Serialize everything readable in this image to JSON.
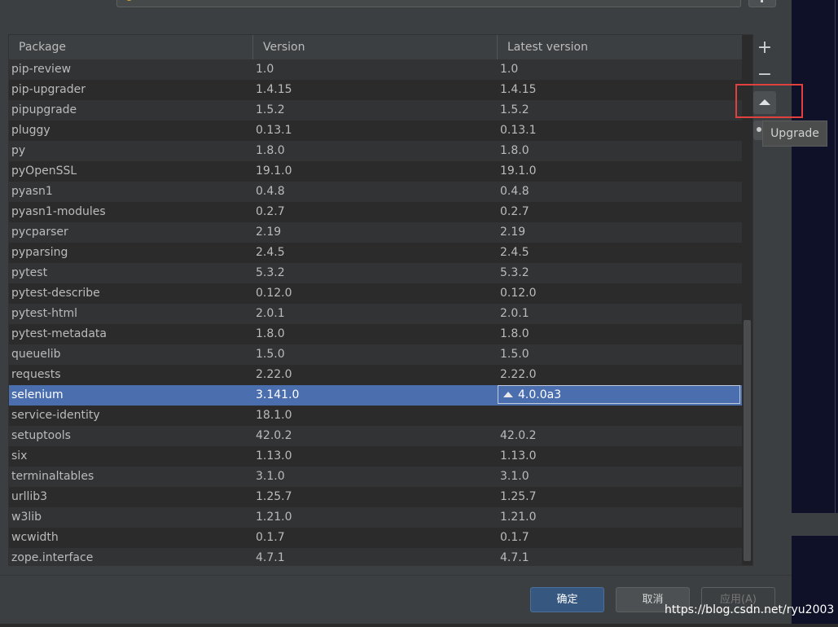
{
  "table": {
    "columns": [
      "Package",
      "Version",
      "Latest version"
    ],
    "rows": [
      {
        "package": "pip-review",
        "version": "1.0",
        "latest": "1.0"
      },
      {
        "package": "pip-upgrader",
        "version": "1.4.15",
        "latest": "1.4.15"
      },
      {
        "package": "pipupgrade",
        "version": "1.5.2",
        "latest": "1.5.2"
      },
      {
        "package": "pluggy",
        "version": "0.13.1",
        "latest": "0.13.1"
      },
      {
        "package": "py",
        "version": "1.8.0",
        "latest": "1.8.0"
      },
      {
        "package": "pyOpenSSL",
        "version": "19.1.0",
        "latest": "19.1.0"
      },
      {
        "package": "pyasn1",
        "version": "0.4.8",
        "latest": "0.4.8"
      },
      {
        "package": "pyasn1-modules",
        "version": "0.2.7",
        "latest": "0.2.7"
      },
      {
        "package": "pycparser",
        "version": "2.19",
        "latest": "2.19"
      },
      {
        "package": "pyparsing",
        "version": "2.4.5",
        "latest": "2.4.5"
      },
      {
        "package": "pytest",
        "version": "5.3.2",
        "latest": "5.3.2"
      },
      {
        "package": "pytest-describe",
        "version": "0.12.0",
        "latest": "0.12.0"
      },
      {
        "package": "pytest-html",
        "version": "2.0.1",
        "latest": "2.0.1"
      },
      {
        "package": "pytest-metadata",
        "version": "1.8.0",
        "latest": "1.8.0"
      },
      {
        "package": "queuelib",
        "version": "1.5.0",
        "latest": "1.5.0"
      },
      {
        "package": "requests",
        "version": "2.22.0",
        "latest": "2.22.0"
      },
      {
        "package": "selenium",
        "version": "3.141.0",
        "latest": "4.0.0a3",
        "selected": true,
        "upgrade_available": true
      },
      {
        "package": "service-identity",
        "version": "18.1.0",
        "latest": ""
      },
      {
        "package": "setuptools",
        "version": "42.0.2",
        "latest": "42.0.2"
      },
      {
        "package": "six",
        "version": "1.13.0",
        "latest": "1.13.0"
      },
      {
        "package": "terminaltables",
        "version": "3.1.0",
        "latest": "3.1.0"
      },
      {
        "package": "urllib3",
        "version": "1.25.7",
        "latest": "1.25.7"
      },
      {
        "package": "w3lib",
        "version": "1.21.0",
        "latest": "1.21.0"
      },
      {
        "package": "wcwidth",
        "version": "0.1.7",
        "latest": "0.1.7"
      },
      {
        "package": "zope.interface",
        "version": "4.7.1",
        "latest": "4.7.1"
      }
    ]
  },
  "toolbar": {
    "add_icon": "plus-icon",
    "remove_icon": "minus-icon",
    "upgrade_icon": "triangle-up-icon",
    "show_early_icon": "eye-icon",
    "add_glyph": "+",
    "remove_glyph": "−"
  },
  "tooltip": {
    "text": "Upgrade"
  },
  "buttons": {
    "ok": "确定",
    "cancel": "取消",
    "apply": "应用(A)"
  },
  "watermark": "https://blog.csdn.net/ryu2003",
  "colors": {
    "background": "#3c3f41",
    "table_bg": "#2b2b2b",
    "row_alt": "#313335",
    "selection": "#4b6eaf",
    "highlight_box": "#e0413f",
    "ok_button": "#365880"
  }
}
